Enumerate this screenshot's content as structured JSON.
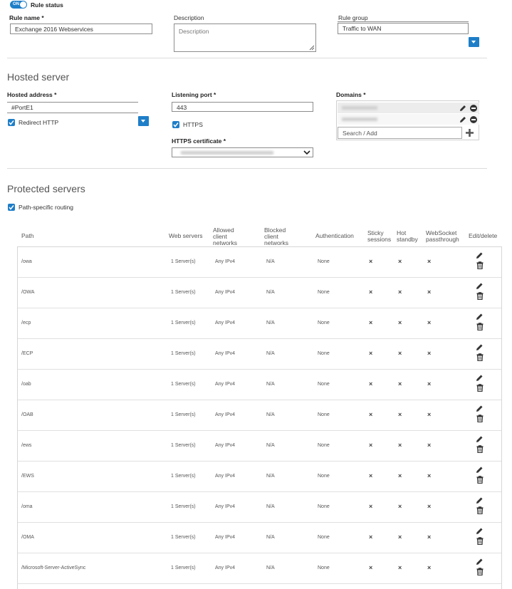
{
  "rule_status": {
    "toggle_text": "ON",
    "label": "Rule status"
  },
  "rule_name": {
    "label": "Rule name *",
    "value": "Exchange 2016 Webservices"
  },
  "description": {
    "label": "Description",
    "placeholder": "Description"
  },
  "rule_group": {
    "label": "Rule group",
    "value": "Traffic to WAN"
  },
  "hosted_server": {
    "title": "Hosted server",
    "address_label": "Hosted address *",
    "address_value": "#PortE1",
    "redirect_http": "Redirect HTTP",
    "port_label": "Listening port *",
    "port_value": "443",
    "https": "HTTPS",
    "cert_label": "HTTPS certificate *",
    "domains_label": "Domains *",
    "domains_search_placeholder": "Search / Add"
  },
  "protected_servers": {
    "title": "Protected servers",
    "path_routing": "Path-specific routing",
    "headers": {
      "path": "Path",
      "web_servers": "Web servers",
      "allowed_1": "Allowed",
      "allowed_2": "client",
      "allowed_3": "networks",
      "blocked_1": "Blocked",
      "blocked_2": "client",
      "blocked_3": "networks",
      "auth": "Authentication",
      "sticky_1": "Sticky",
      "sticky_2": "sessions",
      "hot_1": "Hot",
      "hot_2": "standby",
      "ws_1": "WebSocket",
      "ws_2": "passthrough",
      "edit": "Edit/delete"
    },
    "rows": [
      {
        "path": "/owa",
        "servers": "1 Server(s)",
        "allowed": "Any IPv4",
        "blocked": "N/A",
        "auth": "None",
        "mark": "×"
      },
      {
        "path": "/OWA",
        "servers": "1 Server(s)",
        "allowed": "Any IPv4",
        "blocked": "N/A",
        "auth": "None",
        "mark": "×"
      },
      {
        "path": "/ecp",
        "servers": "1 Server(s)",
        "allowed": "Any IPv4",
        "blocked": "N/A",
        "auth": "None",
        "mark": "×"
      },
      {
        "path": "/ECP",
        "servers": "1 Server(s)",
        "allowed": "Any IPv4",
        "blocked": "N/A",
        "auth": "None",
        "mark": "×"
      },
      {
        "path": "/oab",
        "servers": "1 Server(s)",
        "allowed": "Any IPv4",
        "blocked": "N/A",
        "auth": "None",
        "mark": "×"
      },
      {
        "path": "/OAB",
        "servers": "1 Server(s)",
        "allowed": "Any IPv4",
        "blocked": "N/A",
        "auth": "None",
        "mark": "×"
      },
      {
        "path": "/ews",
        "servers": "1 Server(s)",
        "allowed": "Any IPv4",
        "blocked": "N/A",
        "auth": "None",
        "mark": "×"
      },
      {
        "path": "/EWS",
        "servers": "1 Server(s)",
        "allowed": "Any IPv4",
        "blocked": "N/A",
        "auth": "None",
        "mark": "×"
      },
      {
        "path": "/oma",
        "servers": "1 Server(s)",
        "allowed": "Any IPv4",
        "blocked": "N/A",
        "auth": "None",
        "mark": "×"
      },
      {
        "path": "/OMA",
        "servers": "1 Server(s)",
        "allowed": "Any IPv4",
        "blocked": "N/A",
        "auth": "None",
        "mark": "×"
      },
      {
        "path": "/Microsoft-Server-ActiveSync",
        "servers": "1 Server(s)",
        "allowed": "Any IPv4",
        "blocked": "N/A",
        "auth": "None",
        "mark": "×"
      }
    ]
  },
  "colors": {
    "accent": "#1e7ec8",
    "text": "#333333",
    "divider": "#dcdcdc"
  },
  "icons": [
    "check-icon",
    "chevron-down-icon",
    "pencil-icon",
    "minus-circle-icon",
    "plus-icon",
    "trash-icon"
  ]
}
